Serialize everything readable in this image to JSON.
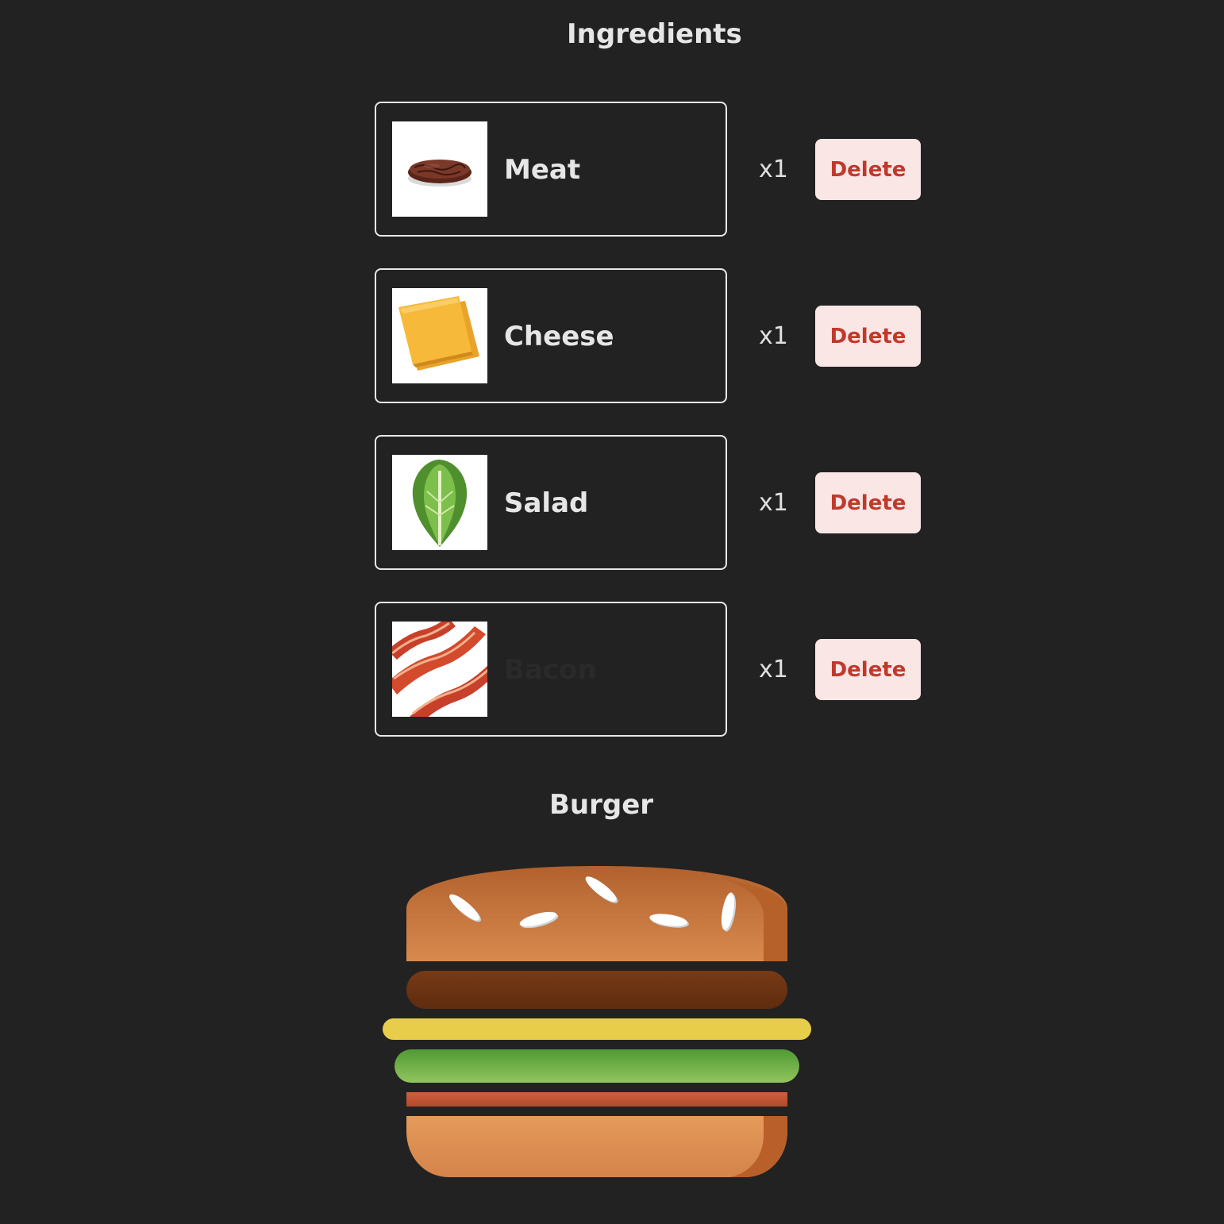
{
  "headings": {
    "ingredients": "Ingredients",
    "burger": "Burger"
  },
  "ingredients": [
    {
      "name": "Meat",
      "quantity": "x1",
      "delete_label": "Delete",
      "icon": "meat-patty-icon",
      "name_dimmed": false
    },
    {
      "name": "Cheese",
      "quantity": "x1",
      "delete_label": "Delete",
      "icon": "cheese-slice-icon",
      "name_dimmed": false
    },
    {
      "name": "Salad",
      "quantity": "x1",
      "delete_label": "Delete",
      "icon": "lettuce-icon",
      "name_dimmed": false
    },
    {
      "name": "Bacon",
      "quantity": "x1",
      "delete_label": "Delete",
      "icon": "bacon-strips-icon",
      "name_dimmed": true
    }
  ],
  "burger_layers": [
    "top-bun",
    "meat",
    "cheese",
    "salad",
    "bacon",
    "bottom-bun"
  ],
  "colors": {
    "background": "#222222",
    "delete_bg": "#fbe6e6",
    "delete_text": "#c0392b",
    "card_border": "#e8e8e8",
    "bun": "#d07d44",
    "meat": "#6b3312",
    "cheese": "#e8cc4a",
    "salad": "#7bb04c",
    "bacon": "#c45a36"
  }
}
